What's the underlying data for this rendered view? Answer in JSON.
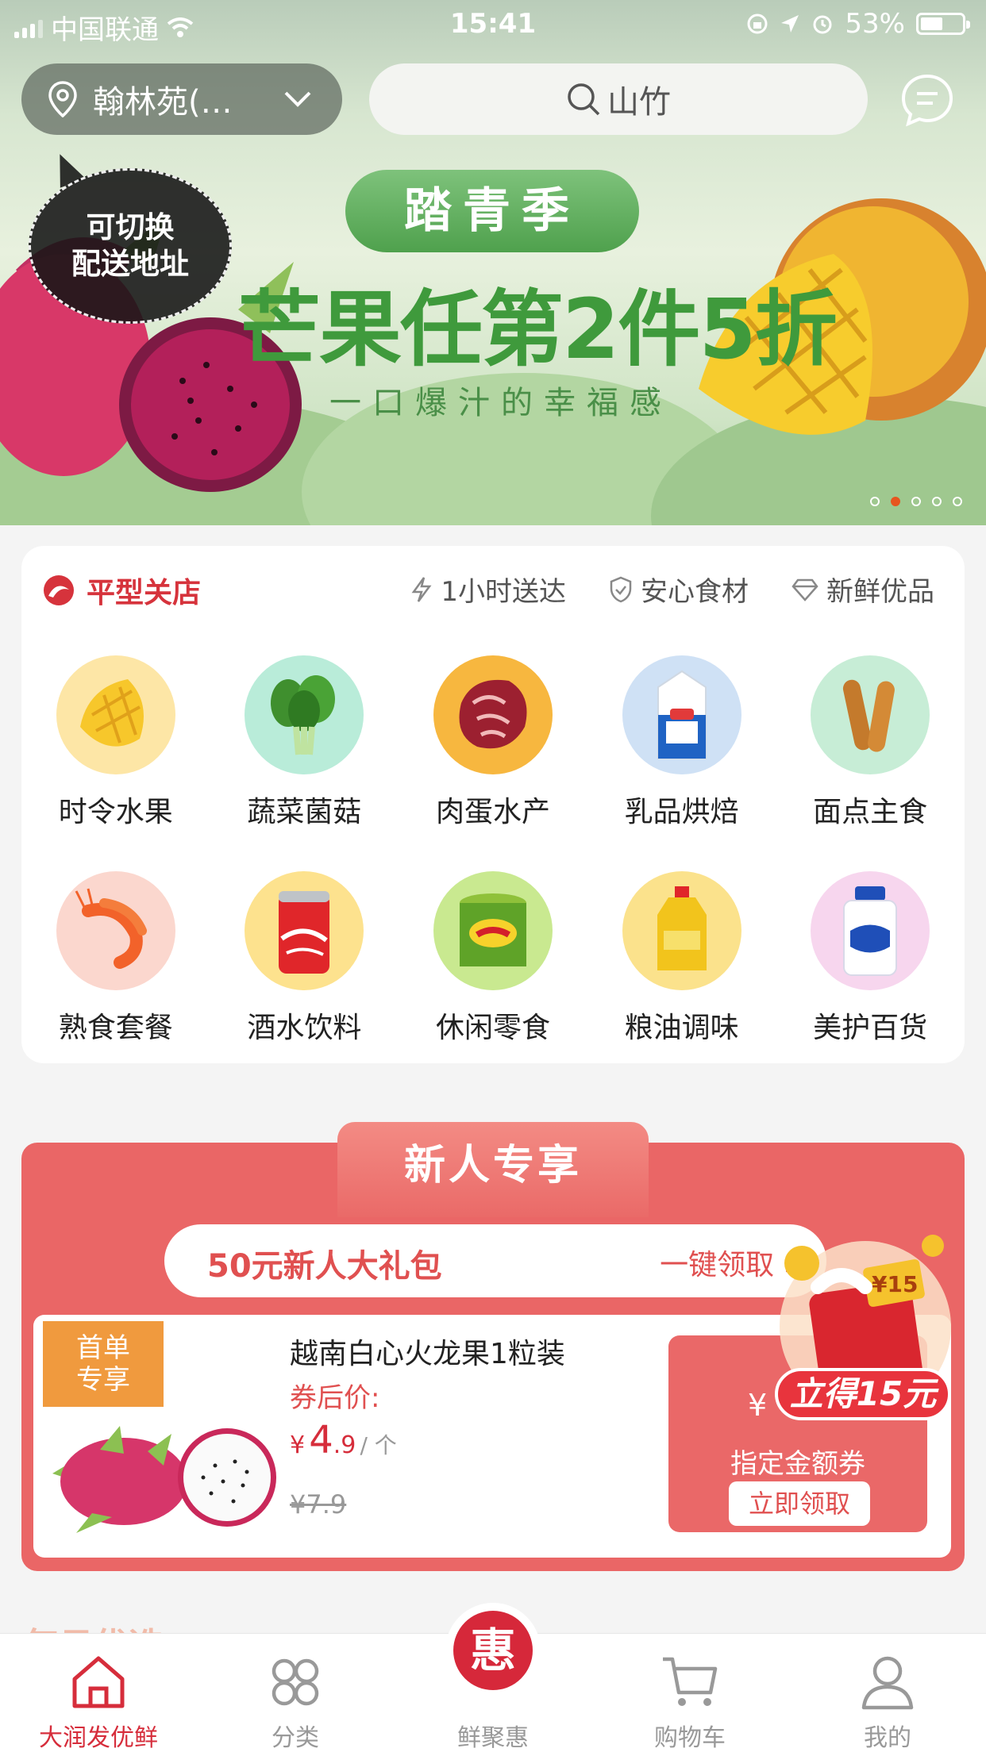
{
  "status_bar": {
    "carrier": "中国联通",
    "time": "15:41",
    "battery": "53%",
    "battery_level": 0.53
  },
  "header": {
    "location_label": "翰林苑(…",
    "search_placeholder": "山竹"
  },
  "banner": {
    "tooltip_line1": "可切换",
    "tooltip_line2": "配送地址",
    "ribbon": "踏青季",
    "headline": "芒果任第2件5折",
    "subline": "一口爆汁的幸福感",
    "slide_count": 5,
    "active_slide": 2
  },
  "store": {
    "name": "平型关店",
    "features": [
      "1小时送达",
      "安心食材",
      "新鲜优品"
    ]
  },
  "categories": [
    {
      "name": "时令水果",
      "icon": "mango-icon",
      "bg": "#fde6a6"
    },
    {
      "name": "蔬菜菌菇",
      "icon": "greens-icon",
      "bg": "#b9ecd9"
    },
    {
      "name": "肉蛋水产",
      "icon": "steak-icon",
      "bg": "#f7b73f"
    },
    {
      "name": "乳品烘焙",
      "icon": "milk-icon",
      "bg": "#cfe1f5"
    },
    {
      "name": "面点主食",
      "icon": "fried-dough-icon",
      "bg": "#c7edd6"
    },
    {
      "name": "熟食套餐",
      "icon": "shrimp-icon",
      "bg": "#fbd7ce"
    },
    {
      "name": "酒水饮料",
      "icon": "cola-can-icon",
      "bg": "#fde28e"
    },
    {
      "name": "休闲零食",
      "icon": "chips-can-icon",
      "bg": "#c9e990"
    },
    {
      "name": "粮油调味",
      "icon": "oil-bottle-icon",
      "bg": "#fbe28c"
    },
    {
      "name": "美护百货",
      "icon": "soap-bottle-icon",
      "bg": "#f7d6ee"
    }
  ],
  "new_user": {
    "title": "新人专享",
    "gift_text": "50元新人大礼包",
    "gift_action": "一键领取",
    "product": {
      "tag_line1": "首单",
      "tag_line2": "专享",
      "name": "越南白心火龙果1粒装",
      "price_label": "券后价:",
      "currency": "¥",
      "price_int": "4",
      "price_dec": ".9",
      "unit": "/ 个",
      "old_price": "¥7.9"
    },
    "coupon": {
      "symbol": "¥",
      "description": "指定金额券",
      "button": "立即领取",
      "reward_text": "立得15元",
      "envelope_mark": "¥15"
    }
  },
  "daily_title": "每日优选",
  "tabbar": [
    {
      "label": "大润发优鲜",
      "icon": "home-icon",
      "active": true
    },
    {
      "label": "分类",
      "icon": "category-icon",
      "active": false
    },
    {
      "label": "鲜聚惠",
      "icon": "hui-icon",
      "active": false,
      "badge": "惠"
    },
    {
      "label": "购物车",
      "icon": "cart-icon",
      "active": false
    },
    {
      "label": "我的",
      "icon": "profile-icon",
      "active": false
    }
  ],
  "colors": {
    "brand_red": "#d62d3b",
    "banner_green": "#3f9a3c",
    "promo_bg": "#ea6666"
  }
}
